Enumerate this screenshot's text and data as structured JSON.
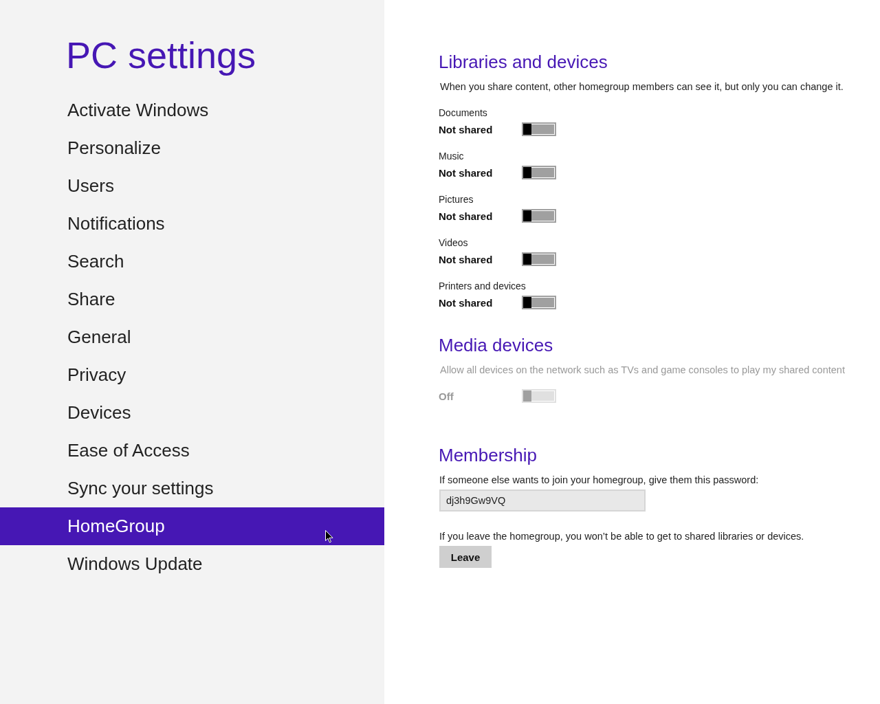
{
  "sidebar": {
    "title": "PC settings",
    "items": [
      {
        "label": "Activate Windows",
        "selected": false
      },
      {
        "label": "Personalize",
        "selected": false
      },
      {
        "label": "Users",
        "selected": false
      },
      {
        "label": "Notifications",
        "selected": false
      },
      {
        "label": "Search",
        "selected": false
      },
      {
        "label": "Share",
        "selected": false
      },
      {
        "label": "General",
        "selected": false
      },
      {
        "label": "Privacy",
        "selected": false
      },
      {
        "label": "Devices",
        "selected": false
      },
      {
        "label": "Ease of Access",
        "selected": false
      },
      {
        "label": "Sync your settings",
        "selected": false
      },
      {
        "label": "HomeGroup",
        "selected": true
      },
      {
        "label": "Windows Update",
        "selected": false
      }
    ]
  },
  "libraries": {
    "heading": "Libraries and devices",
    "description": "When you share content, other homegroup members can see it, but only you can change it.",
    "items": [
      {
        "name": "Documents",
        "status": "Not shared",
        "on": false
      },
      {
        "name": "Music",
        "status": "Not shared",
        "on": false
      },
      {
        "name": "Pictures",
        "status": "Not shared",
        "on": false
      },
      {
        "name": "Videos",
        "status": "Not shared",
        "on": false
      },
      {
        "name": "Printers and devices",
        "status": "Not shared",
        "on": false
      }
    ]
  },
  "media": {
    "heading": "Media devices",
    "description": "Allow all devices on the network such as TVs and game consoles to play my shared content",
    "status": "Off",
    "on": false,
    "disabled": true
  },
  "membership": {
    "heading": "Membership",
    "password_prompt": "If someone else wants to join your homegroup, give them this password:",
    "password": "dj3h9Gw9VQ",
    "leave_note": "If you leave the homegroup, you won’t be able to get to shared libraries or devices.",
    "leave_button": "Leave"
  }
}
